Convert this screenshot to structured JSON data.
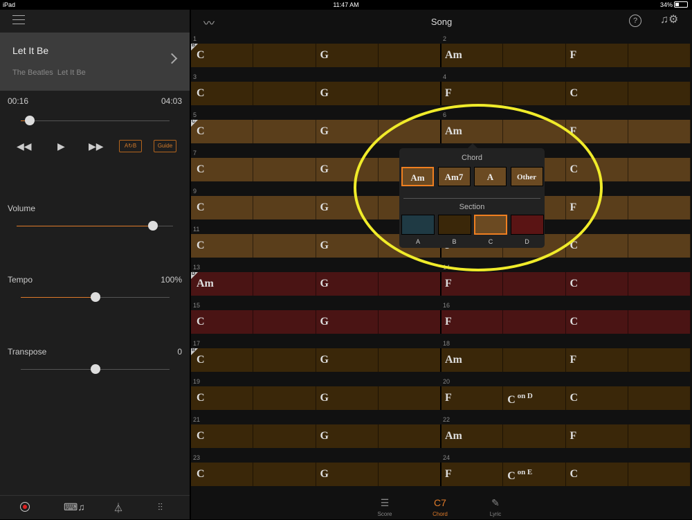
{
  "statusbar": {
    "device": "iPad",
    "time": "11:47 AM",
    "battery": "34%"
  },
  "left": {
    "song": {
      "title": "Let It Be",
      "artist": "The Beatles",
      "album": "Let It Be"
    },
    "position": {
      "elapsed": "00:16",
      "total": "04:03",
      "fraction": 0.06
    },
    "transport": {
      "rewind": "◀◀",
      "play": "▶",
      "forward": "▶▶",
      "ab": "A↻B",
      "guide": "Guide"
    },
    "volume": {
      "label": "Volume",
      "fraction": 0.87
    },
    "tempo": {
      "label": "Tempo",
      "value": "100%",
      "fraction": 0.5
    },
    "transpose": {
      "label": "Transpose",
      "value": "0",
      "fraction": 0.5
    }
  },
  "nav": {
    "title": "Song",
    "help": "?"
  },
  "rows": [
    {
      "bars": [
        {
          "n": "1",
          "section": "B",
          "chords": [
            "C",
            "",
            "G",
            ""
          ]
        },
        {
          "n": "2",
          "chords": [
            "Am",
            "",
            "F",
            ""
          ]
        }
      ],
      "color": "#3a2709"
    },
    {
      "bars": [
        {
          "n": "3",
          "chords": [
            "C",
            "",
            "G",
            ""
          ]
        },
        {
          "n": "4",
          "chords": [
            "F",
            "",
            "C",
            ""
          ]
        }
      ],
      "color": "#3a2709"
    },
    {
      "bars": [
        {
          "n": "5",
          "section": "C",
          "chords": [
            "C",
            "",
            "G",
            ""
          ]
        },
        {
          "n": "6",
          "chords": [
            "Am",
            "",
            "F",
            ""
          ]
        }
      ],
      "color": "#5a3e1b"
    },
    {
      "bars": [
        {
          "n": "7",
          "chords": [
            "C",
            "",
            "G",
            ""
          ]
        },
        {
          "n": "",
          "chords": [
            "",
            "",
            "C",
            ""
          ]
        }
      ],
      "color": "#5a3e1b"
    },
    {
      "bars": [
        {
          "n": "9",
          "chords": [
            "C",
            "",
            "G",
            ""
          ]
        },
        {
          "n": "",
          "chords": [
            "",
            "",
            "F",
            ""
          ]
        }
      ],
      "color": "#5a3e1b"
    },
    {
      "bars": [
        {
          "n": "11",
          "chords": [
            "C",
            "",
            "G",
            ""
          ]
        },
        {
          "n": "",
          "chords": [
            "F",
            "",
            "C",
            ""
          ]
        }
      ],
      "color": "#5a3e1b"
    },
    {
      "bars": [
        {
          "n": "13",
          "section": "D",
          "chords": [
            "Am",
            "",
            "G",
            ""
          ]
        },
        {
          "n": "14",
          "chords": [
            "F",
            "",
            "C",
            ""
          ]
        }
      ],
      "color": "#4a1414"
    },
    {
      "bars": [
        {
          "n": "15",
          "chords": [
            "C",
            "",
            "G",
            ""
          ]
        },
        {
          "n": "16",
          "chords": [
            "F",
            "",
            "C",
            ""
          ]
        }
      ],
      "color": "#4a1414"
    },
    {
      "bars": [
        {
          "n": "17",
          "section": "B",
          "chords": [
            "C",
            "",
            "G",
            ""
          ]
        },
        {
          "n": "18",
          "chords": [
            "Am",
            "",
            "F",
            ""
          ]
        }
      ],
      "color": "#3a2709"
    },
    {
      "bars": [
        {
          "n": "19",
          "chords": [
            "C",
            "",
            "G",
            ""
          ]
        },
        {
          "n": "20",
          "chords": [
            "F",
            "C|on D",
            "C",
            ""
          ]
        }
      ],
      "color": "#3a2709"
    },
    {
      "bars": [
        {
          "n": "21",
          "chords": [
            "C",
            "",
            "G",
            ""
          ]
        },
        {
          "n": "22",
          "chords": [
            "Am",
            "",
            "F",
            ""
          ]
        }
      ],
      "color": "#3a2709"
    },
    {
      "bars": [
        {
          "n": "23",
          "chords": [
            "C",
            "",
            "G",
            ""
          ]
        },
        {
          "n": "24",
          "chords": [
            "F",
            "C|on E",
            "C",
            ""
          ]
        }
      ],
      "color": "#3a2709"
    }
  ],
  "popup": {
    "chord_title": "Chord",
    "chords": [
      {
        "label": "Am",
        "selected": true
      },
      {
        "label": "Am7",
        "selected": false
      },
      {
        "label": "A",
        "selected": false
      },
      {
        "label": "Other",
        "selected": false
      }
    ],
    "section_title": "Section",
    "sections": [
      {
        "label": "A",
        "color": "#1f3a44",
        "selected": false
      },
      {
        "label": "B",
        "color": "#3a2709",
        "selected": false
      },
      {
        "label": "C",
        "color": "#6b4a22",
        "selected": true
      },
      {
        "label": "D",
        "color": "#5a1414",
        "selected": false
      }
    ]
  },
  "tabs": [
    {
      "label": "Score",
      "icon": "☰",
      "active": false
    },
    {
      "label": "Chord",
      "icon": "C7",
      "active": true
    },
    {
      "label": "Lyric",
      "icon": "✎",
      "active": false
    }
  ]
}
